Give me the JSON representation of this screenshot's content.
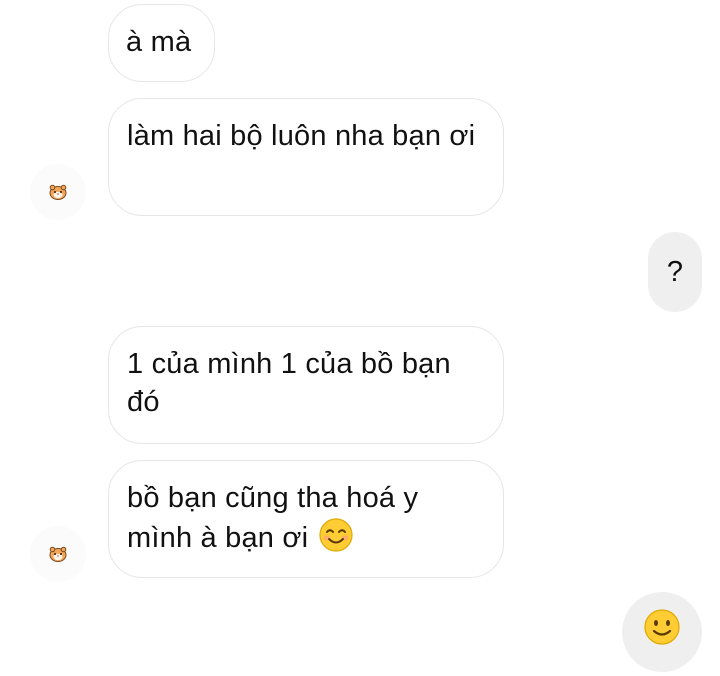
{
  "thread": {
    "messages": [
      {
        "from": "them",
        "text": "à mà"
      },
      {
        "from": "them",
        "text": "làm hai bộ luôn nha bạn ơi"
      },
      {
        "from": "me",
        "text": "?"
      },
      {
        "from": "them",
        "text": "1 của mình 1 của bồ bạn đó"
      },
      {
        "from": "them",
        "text": "bồ bạn cũng tha hoá y mình à bạn ơi",
        "emoji": "smiling-face-with-smiling-eyes"
      },
      {
        "from": "me",
        "emoji": "slightly-smiling-face"
      }
    ]
  },
  "avatar": {
    "icon": "hamster-icon"
  },
  "colors": {
    "incoming_bubble": "#ffffff",
    "incoming_border": "#e6e6e6",
    "outgoing_bubble": "#efefef",
    "text": "#111111",
    "emoji_yellow": "#ffcc33"
  }
}
